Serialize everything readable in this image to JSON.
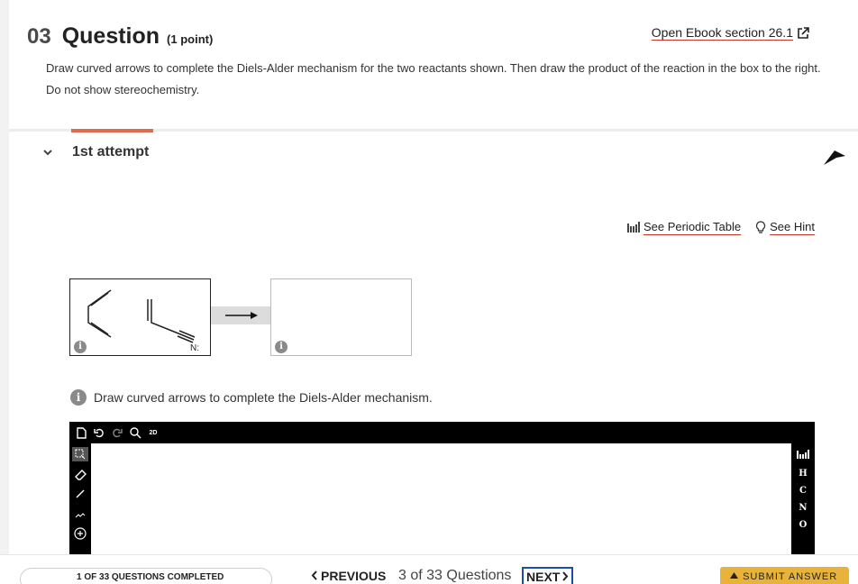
{
  "question": {
    "number": "03",
    "title": "Question",
    "points": "(1 point)",
    "ebook_link": "Open Ebook section 26.1",
    "instructions": "Draw curved arrows to complete the Diels-Alder mechanism for the two reactants shown. Then draw the product of the reaction in the box to the right. Do not show stereochemistry."
  },
  "attempt": {
    "label": "1st attempt"
  },
  "resources": {
    "periodic_table": "See Periodic Table",
    "hint": "See Hint"
  },
  "reaction": {
    "nitrogen_label": "N:",
    "info_glyph": "i"
  },
  "editor_hint": "Draw curved arrows to complete the Diels-Alder mechanism.",
  "editor": {
    "top_tools": [
      "new-doc-icon",
      "undo-icon",
      "redo-icon",
      "zoom-icon",
      "2d-clean-icon"
    ],
    "left_tools": [
      "select-icon",
      "eraser-icon",
      "bond-icon",
      "chain-icon",
      "charge-plus-icon"
    ],
    "elements": [
      "H",
      "C",
      "N",
      "O"
    ],
    "clean_label": "2D"
  },
  "footer": {
    "progress": "1 OF 33 QUESTIONS COMPLETED",
    "previous": "PREVIOUS",
    "counter": "3 of 33 Questions",
    "next": "NEXT",
    "submit": "SUBMIT ANSWER"
  },
  "colors": {
    "accent": "#e06a4e",
    "submit": "#e8b33a",
    "next_border": "#1a4fa3"
  }
}
